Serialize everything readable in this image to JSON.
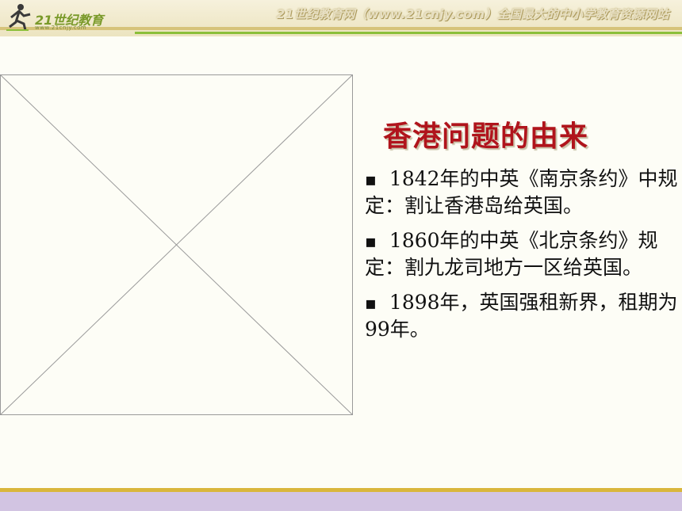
{
  "header": {
    "logo_brand": "21世纪教育",
    "logo_url": "www.21cnjy.com",
    "site_text": "21世纪教育网（www.21cnjy.com）全国最大的中小学教育资源网站"
  },
  "slide": {
    "title": "香港问题的由来",
    "bullets": [
      {
        "marker": "▪",
        "text": "1842年的中英《南京条约》中规定：割让香港岛给英国。"
      },
      {
        "marker": "▪",
        "text": "1860年的中英《北京条约》规定：割九龙司地方一区给英国。"
      },
      {
        "marker": "▪",
        "text": "1898年，英国强租新界，租期为99年。"
      }
    ]
  },
  "colors": {
    "title": "#b0141c",
    "footer_gold": "#d9b63c",
    "footer_lilac": "#d2c4e2",
    "accent_green": "#8bbf3a"
  },
  "icons": [
    "runner-logo-icon"
  ]
}
